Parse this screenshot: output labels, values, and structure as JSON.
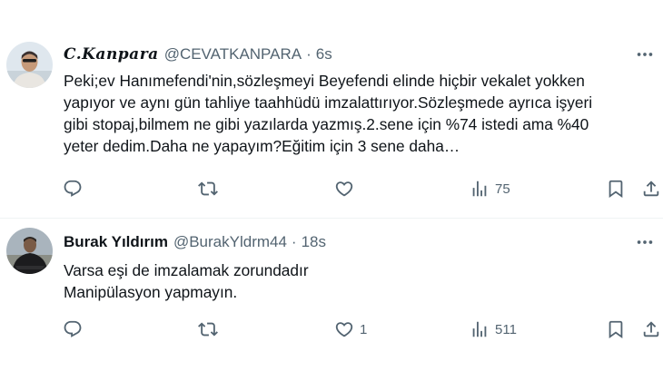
{
  "tweets": [
    {
      "display_name": "C.𝑲𝒂𝒏𝒑𝒂𝒓𝒂",
      "handle": "@CEVATKANPARA",
      "separator": "·",
      "time": "6s",
      "text": "Peki;ev Hanımefendi'nin,sözleşmeyi Beyefendi elinde hiçbir vekalet yokken\nyapıyor ve aynı gün tahliye taahhüdü imzalattırıyor.Sözleşmede ayrıca işyeri\ngibi stopaj,bilmem ne gibi yazılarda yazmış.2.sene için %74 istedi ama %40\nyeter dedim.Daha ne yapayım?Eğitim için 3 sene daha…",
      "reply_count": "",
      "retweet_count": "",
      "like_count": "",
      "view_count": "75"
    },
    {
      "display_name": "Burak Yıldırım",
      "handle": "@BurakYldrm44",
      "separator": "·",
      "time": "18s",
      "text": "Varsa eşi de imzalamak zorundadır\nManipülasyon yapmayın.",
      "reply_count": "",
      "retweet_count": "",
      "like_count": "1",
      "view_count": "511"
    }
  ],
  "icons": {
    "more": "more-horizontal-icon",
    "reply": "reply-icon",
    "retweet": "retweet-icon",
    "like": "heart-icon",
    "views": "views-chart-icon",
    "bookmark": "bookmark-icon",
    "share": "share-icon"
  },
  "colors": {
    "text": "#0f1419",
    "secondary": "#536471",
    "divider": "#eff3f4",
    "background": "#ffffff"
  }
}
